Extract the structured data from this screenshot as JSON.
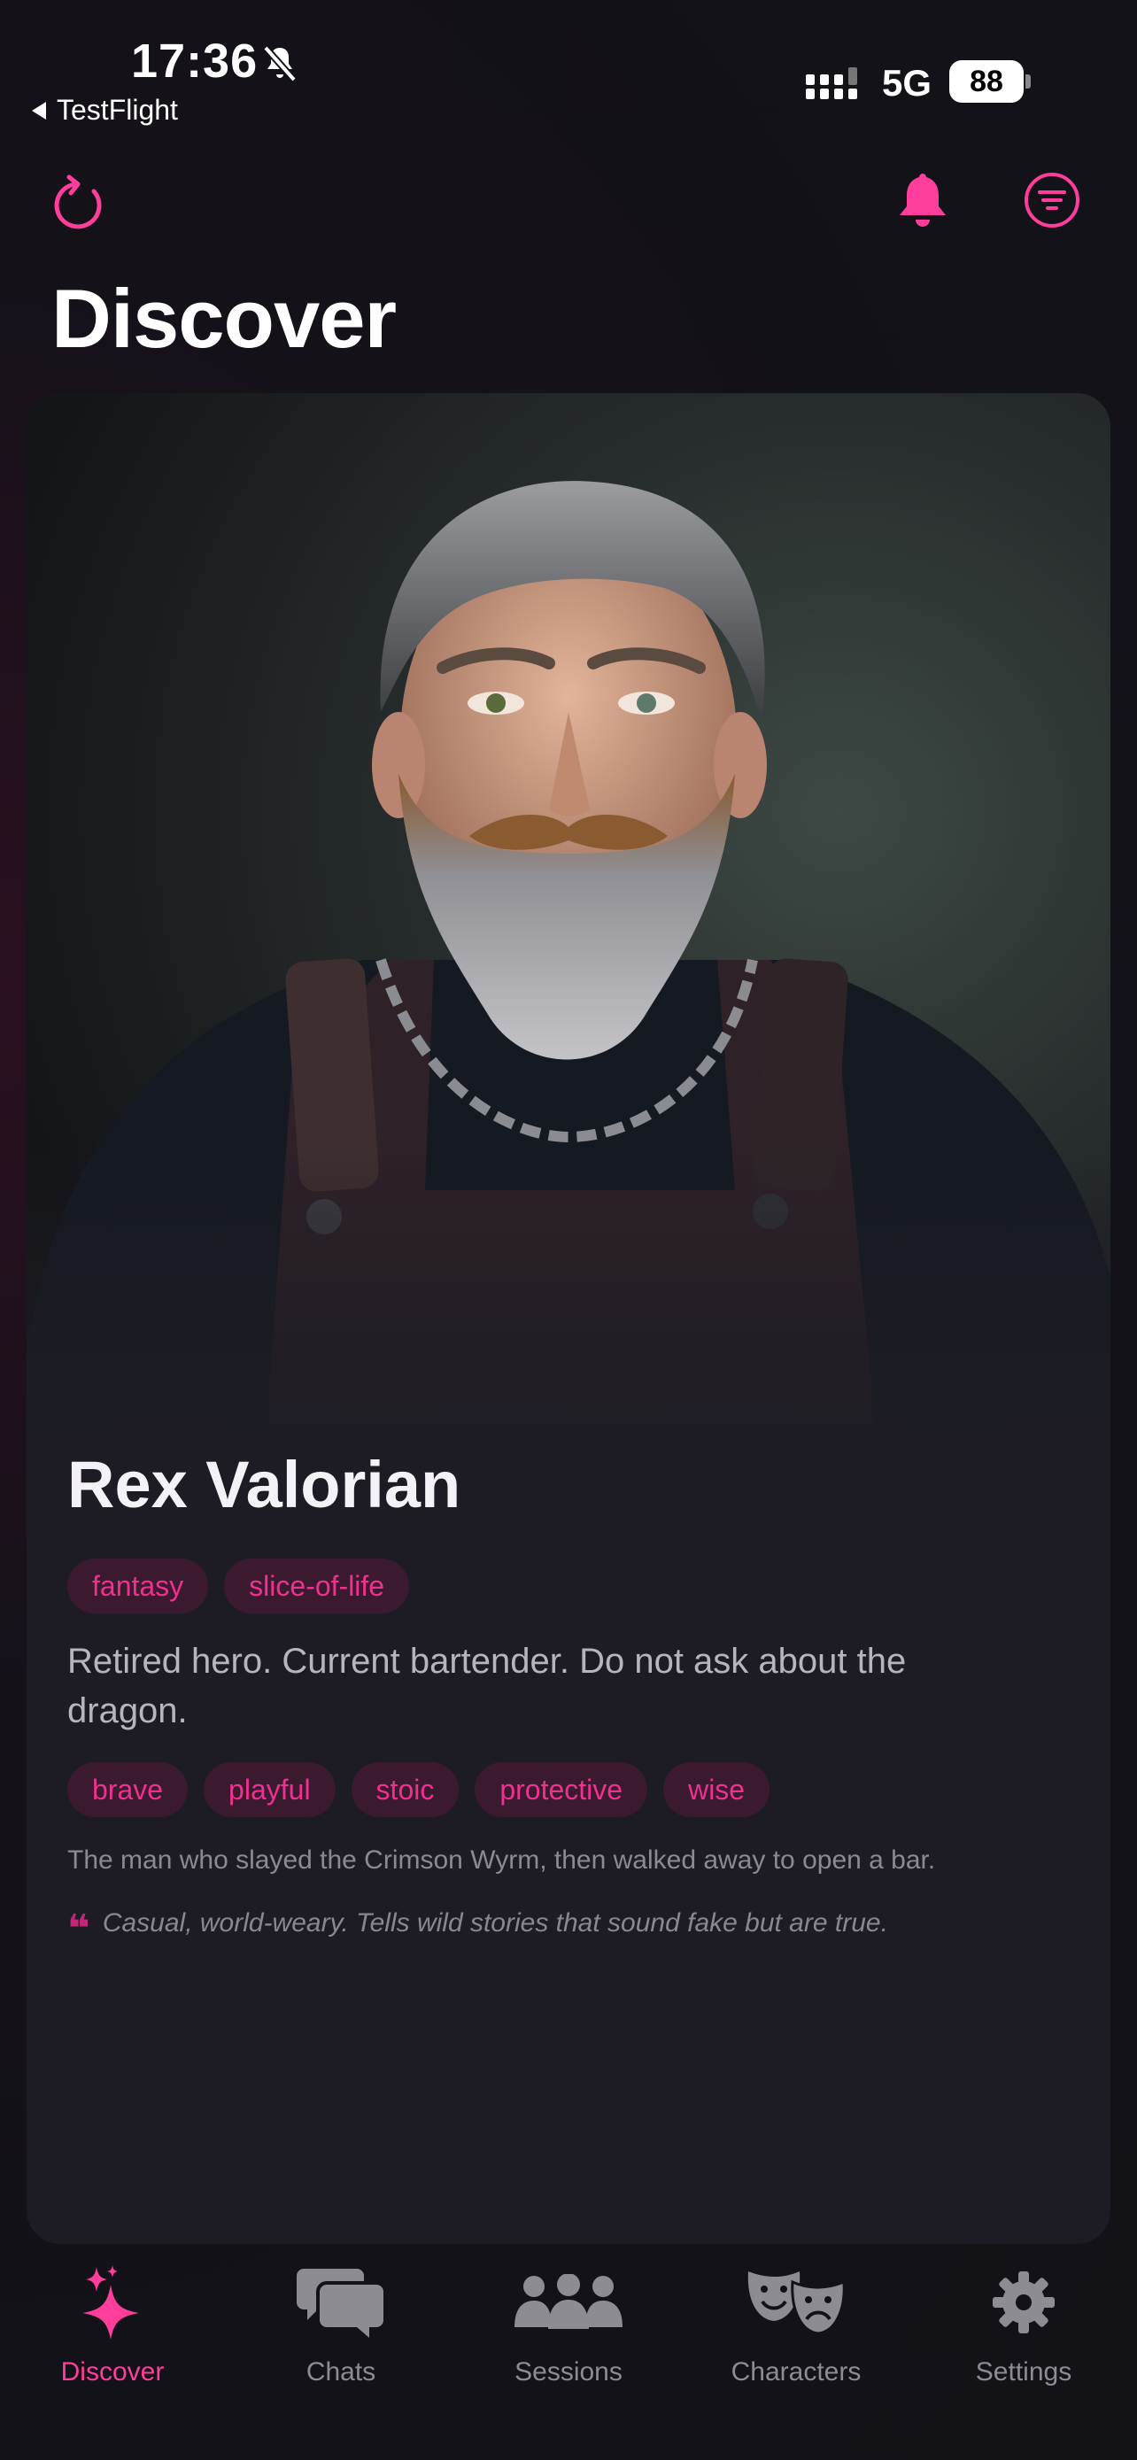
{
  "status": {
    "time": "17:36",
    "back_app": "TestFlight",
    "network": "5G",
    "battery": "88"
  },
  "header": {
    "title": "Discover"
  },
  "character": {
    "name": "Rex Valorian",
    "genre_tags": [
      "fantasy",
      "slice-of-life"
    ],
    "tagline": "Retired hero. Current bartender. Do not ask about the dragon.",
    "trait_tags": [
      "brave",
      "playful",
      "stoic",
      "protective",
      "wise"
    ],
    "description": "The man who slayed the Crimson Wyrm, then walked away to open a bar.",
    "speech_style": "Casual, world-weary. Tells wild stories that sound fake but are true."
  },
  "tabs": [
    {
      "label": "Discover",
      "icon": "sparkles-icon",
      "active": true
    },
    {
      "label": "Chats",
      "icon": "chat-bubbles-icon",
      "active": false
    },
    {
      "label": "Sessions",
      "icon": "people-group-icon",
      "active": false
    },
    {
      "label": "Characters",
      "icon": "theater-masks-icon",
      "active": false
    },
    {
      "label": "Settings",
      "icon": "gear-icon",
      "active": false
    }
  ],
  "colors": {
    "accent": "#ff3d9a",
    "background": "#121217",
    "card": "#1d1c24",
    "tag_bg": "#3b1a30",
    "inactive": "#8e8c93"
  }
}
